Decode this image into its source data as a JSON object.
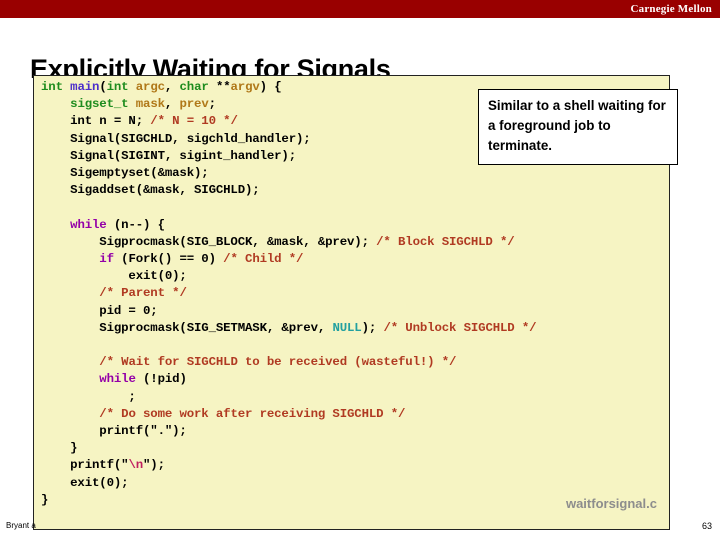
{
  "banner": {
    "institution": "Carnegie Mellon",
    "color": "#990000"
  },
  "slide": {
    "title": "Explicitly Waiting for Signals",
    "page_number": "63",
    "author_footer": "Bryant a"
  },
  "callout": {
    "text": "Similar to a shell waiting for a foreground job to terminate."
  },
  "code": {
    "filename_watermark": "waitforsignal.c",
    "background_color": "#f6f4c3",
    "language": "c",
    "colors": {
      "keyword": "#9400a8",
      "type": "#1e8c1e",
      "function": "#4b2ecb",
      "parameter": "#b07818",
      "comment": "#b03a22",
      "null_literal": "#22a0a0",
      "escape": "#c02060",
      "plain": "#000000"
    },
    "lines": [
      "int main(int argc, char **argv) {",
      "    sigset_t mask, prev;",
      "    int n = N; /* N = 10 */",
      "    Signal(SIGCHLD, sigchld_handler);",
      "    Signal(SIGINT, sigint_handler);",
      "    Sigemptyset(&mask);",
      "    Sigaddset(&mask, SIGCHLD);",
      "",
      "    while (n--) {",
      "        Sigprocmask(SIG_BLOCK, &mask, &prev); /* Block SIGCHLD */",
      "        if (Fork() == 0) /* Child */",
      "            exit(0);",
      "        /* Parent */",
      "        pid = 0;",
      "        Sigprocmask(SIG_SETMASK, &prev, NULL); /* Unblock SIGCHLD */",
      "",
      "        /* Wait for SIGCHLD to be received (wasteful!) */",
      "        while (!pid)",
      "            ;",
      "        /* Do some work after receiving SIGCHLD */",
      "        printf(\".\");",
      "    }",
      "    printf(\"\\n\");",
      "    exit(0);",
      "}"
    ]
  }
}
